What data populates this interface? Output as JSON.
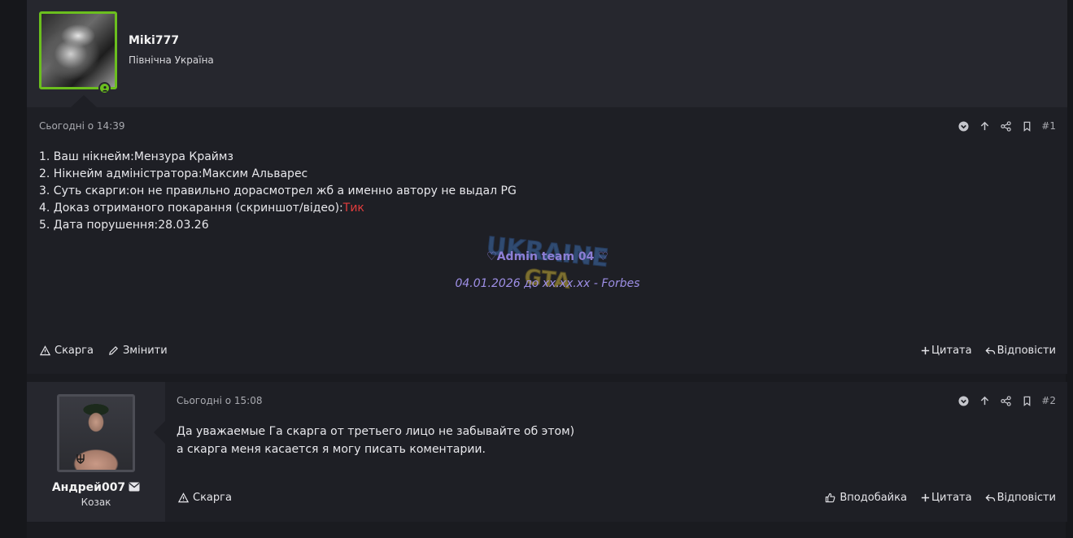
{
  "post1": {
    "username": "Miki777",
    "user_title": "Північна Україна",
    "date": "Сьогодні о 14:39",
    "number": "#1",
    "body_lines": [
      "1. Ваш нікнейм:Мензура Краймз",
      "2. Нікнейм адміністратора:Максим Альварес",
      "3. Суть скарги:он не правильно дорасмотрел жб а именно автору не выдал PG",
      "4. Доказ отриманого покарання (скриншот/відео):",
      "5. Дата порушення:28.03.26"
    ],
    "evidence_link": "Тик",
    "signature": {
      "line1": "♡Admin team 04 ♡",
      "line2": "04.01.2026 до xx.xx.xx - Forbes",
      "watermark": "UKRAINE GTA"
    },
    "actions_left": [
      "Скарга",
      "Змінити"
    ],
    "actions_right": [
      "Цитата",
      "Відповісти"
    ]
  },
  "post2": {
    "username": "Андрей007",
    "user_title": "Козак",
    "date": "Сьогодні о 15:08",
    "number": "#2",
    "body_lines": [
      "Да уважаемые Га скарга от третьего лицо не забывайте об этом)",
      "а скарга меня касается я могу писать коментарии."
    ],
    "actions_left": [
      "Скарга"
    ],
    "actions_right": [
      "Вподобайка",
      "Цитата",
      "Відповісти"
    ]
  },
  "colors": {
    "online_border": "#6bbf1e",
    "link_red": "#e03c3c",
    "signature_purple": "#8e7fd6"
  }
}
